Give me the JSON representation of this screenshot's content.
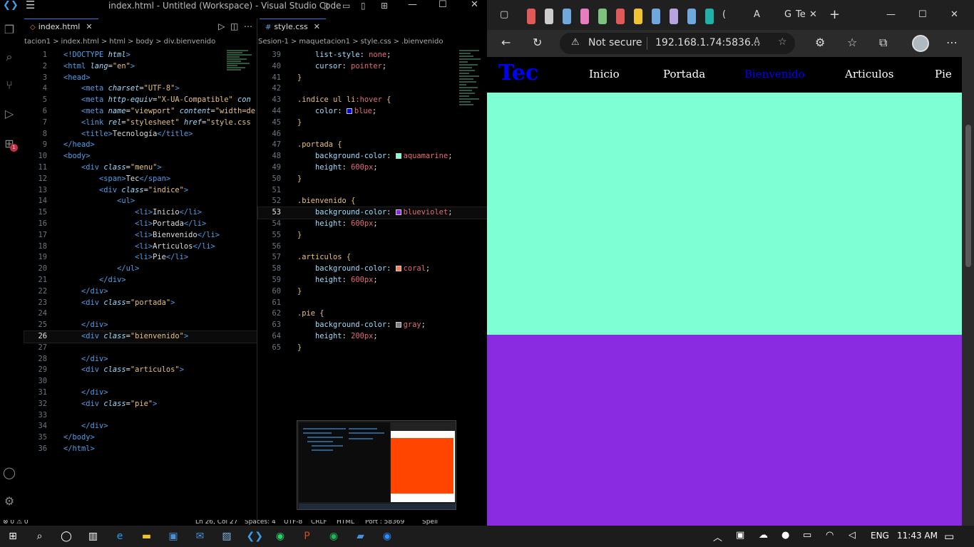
{
  "vscode": {
    "title": "index.html - Untitled (Workspace) - Visual Studio Code",
    "left_tab": "index.html",
    "left_breadcrumbs": [
      "tacion1",
      ">",
      "index.html",
      ">",
      "html",
      ">",
      "body",
      ">",
      "div.bienvenido"
    ],
    "right_tab": "style.css",
    "right_breadcrumbs": [
      "Sesion-1",
      ">",
      "maquetacion1",
      ">",
      "style.css",
      ">",
      ".bienvenido"
    ],
    "extensions_badge": "1",
    "status_items": [
      "⊗ 0 ⚠ 0",
      "Ln 26, Col 27",
      "Spaces: 4",
      "UTF-8",
      "CRLF",
      "HTML",
      "Port : 58369",
      "Spell"
    ],
    "html_lines": [
      {
        "n": "1",
        "segs": [
          [
            "tg",
            "<!DOCTYPE "
          ],
          [
            "at",
            "html"
          ],
          [
            "tg",
            ">"
          ]
        ]
      },
      {
        "n": "2",
        "segs": [
          [
            "tg",
            "<html "
          ],
          [
            "at",
            "lang"
          ],
          [
            "",
            "="
          ],
          [
            "st",
            "\"en\""
          ],
          [
            "tg",
            ">"
          ]
        ]
      },
      {
        "n": "3",
        "segs": [
          [
            "tg",
            "<head>"
          ]
        ]
      },
      {
        "n": "4",
        "segs": [
          [
            "",
            "    "
          ],
          [
            "tg",
            "<meta "
          ],
          [
            "at",
            "charset"
          ],
          [
            "",
            "="
          ],
          [
            "st",
            "\"UTF-8\""
          ],
          [
            "tg",
            ">"
          ]
        ]
      },
      {
        "n": "5",
        "segs": [
          [
            "",
            "    "
          ],
          [
            "tg",
            "<meta "
          ],
          [
            "at",
            "http-equiv"
          ],
          [
            "",
            "="
          ],
          [
            "st",
            "\"X-UA-Compatible\""
          ],
          [
            "at",
            " con"
          ]
        ]
      },
      {
        "n": "6",
        "segs": [
          [
            "",
            "    "
          ],
          [
            "tg",
            "<meta "
          ],
          [
            "at",
            "name"
          ],
          [
            "",
            "="
          ],
          [
            "st",
            "\"viewport\""
          ],
          [
            "at",
            " content"
          ],
          [
            "",
            "="
          ],
          [
            "st",
            "\"width=de"
          ]
        ]
      },
      {
        "n": "7",
        "segs": [
          [
            "",
            "    "
          ],
          [
            "tg",
            "<link "
          ],
          [
            "at",
            "rel"
          ],
          [
            "",
            "="
          ],
          [
            "st",
            "\"stylesheet\""
          ],
          [
            "at",
            " href"
          ],
          [
            "",
            "="
          ],
          [
            "st",
            "\"style.css"
          ]
        ]
      },
      {
        "n": "8",
        "segs": [
          [
            "",
            "    "
          ],
          [
            "tg",
            "<title>"
          ],
          [
            "",
            "Tecnología"
          ],
          [
            "tg",
            "</title>"
          ]
        ]
      },
      {
        "n": "9",
        "segs": [
          [
            "tg",
            "</head>"
          ]
        ]
      },
      {
        "n": "10",
        "segs": [
          [
            "tg",
            "<body>"
          ]
        ]
      },
      {
        "n": "11",
        "segs": [
          [
            "",
            "    "
          ],
          [
            "tg",
            "<div "
          ],
          [
            "at",
            "class"
          ],
          [
            "",
            "="
          ],
          [
            "st",
            "\"menu\""
          ],
          [
            "tg",
            ">"
          ]
        ]
      },
      {
        "n": "12",
        "segs": [
          [
            "",
            "        "
          ],
          [
            "tg",
            "<span>"
          ],
          [
            "",
            "Tec"
          ],
          [
            "tg",
            "</span>"
          ]
        ]
      },
      {
        "n": "13",
        "segs": [
          [
            "",
            "        "
          ],
          [
            "tg",
            "<div "
          ],
          [
            "at",
            "class"
          ],
          [
            "",
            "="
          ],
          [
            "st",
            "\"indice\""
          ],
          [
            "tg",
            ">"
          ]
        ]
      },
      {
        "n": "14",
        "segs": [
          [
            "",
            "            "
          ],
          [
            "tg",
            "<ul>"
          ]
        ]
      },
      {
        "n": "15",
        "segs": [
          [
            "",
            "                "
          ],
          [
            "tg",
            "<li>"
          ],
          [
            "",
            "Inicio"
          ],
          [
            "tg",
            "</li>"
          ]
        ]
      },
      {
        "n": "16",
        "segs": [
          [
            "",
            "                "
          ],
          [
            "tg",
            "<li>"
          ],
          [
            "",
            "Portada"
          ],
          [
            "tg",
            "</li>"
          ]
        ]
      },
      {
        "n": "17",
        "segs": [
          [
            "",
            "                "
          ],
          [
            "tg",
            "<li>"
          ],
          [
            "",
            "Bienvenido"
          ],
          [
            "tg",
            "</li>"
          ]
        ]
      },
      {
        "n": "18",
        "segs": [
          [
            "",
            "                "
          ],
          [
            "tg",
            "<li>"
          ],
          [
            "",
            "Articulos"
          ],
          [
            "tg",
            "</li>"
          ]
        ]
      },
      {
        "n": "19",
        "segs": [
          [
            "",
            "                "
          ],
          [
            "tg",
            "<li>"
          ],
          [
            "",
            "Pie"
          ],
          [
            "tg",
            "</li>"
          ]
        ]
      },
      {
        "n": "20",
        "segs": [
          [
            "",
            "            "
          ],
          [
            "tg",
            "</ul>"
          ]
        ]
      },
      {
        "n": "21",
        "segs": [
          [
            "",
            "        "
          ],
          [
            "tg",
            "</div>"
          ]
        ]
      },
      {
        "n": "22",
        "segs": [
          [
            "",
            "    "
          ],
          [
            "tg",
            "</div>"
          ]
        ]
      },
      {
        "n": "23",
        "segs": [
          [
            "",
            "    "
          ],
          [
            "tg",
            "<div "
          ],
          [
            "at",
            "class"
          ],
          [
            "",
            "="
          ],
          [
            "st",
            "\"portada\""
          ],
          [
            "tg",
            ">"
          ]
        ]
      },
      {
        "n": "24",
        "segs": [
          [
            "",
            ""
          ]
        ]
      },
      {
        "n": "25",
        "segs": [
          [
            "",
            "    "
          ],
          [
            "tg",
            "</div>"
          ]
        ]
      },
      {
        "n": "26",
        "segs": [
          [
            "",
            "    "
          ],
          [
            "tg",
            "<div "
          ],
          [
            "at",
            "class"
          ],
          [
            "",
            "="
          ],
          [
            "st",
            "\"bienvenido\""
          ],
          [
            "tg",
            ">"
          ]
        ],
        "current": true
      },
      {
        "n": "27",
        "segs": [
          [
            "",
            ""
          ]
        ]
      },
      {
        "n": "28",
        "segs": [
          [
            "",
            "    "
          ],
          [
            "tg",
            "</div>"
          ]
        ]
      },
      {
        "n": "29",
        "segs": [
          [
            "",
            "    "
          ],
          [
            "tg",
            "<div "
          ],
          [
            "at",
            "class"
          ],
          [
            "",
            "="
          ],
          [
            "st",
            "\"articulos\""
          ],
          [
            "tg",
            ">"
          ]
        ]
      },
      {
        "n": "30",
        "segs": [
          [
            "",
            ""
          ]
        ]
      },
      {
        "n": "31",
        "segs": [
          [
            "",
            "    "
          ],
          [
            "tg",
            "</div>"
          ]
        ]
      },
      {
        "n": "32",
        "segs": [
          [
            "",
            "    "
          ],
          [
            "tg",
            "<div "
          ],
          [
            "at",
            "class"
          ],
          [
            "",
            "="
          ],
          [
            "st",
            "\"pie\""
          ],
          [
            "tg",
            ">"
          ]
        ]
      },
      {
        "n": "33",
        "segs": [
          [
            "",
            ""
          ]
        ]
      },
      {
        "n": "34",
        "segs": [
          [
            "",
            "    "
          ],
          [
            "tg",
            "</div>"
          ]
        ]
      },
      {
        "n": "35",
        "segs": [
          [
            "tg",
            "</body>"
          ]
        ]
      },
      {
        "n": "36",
        "segs": [
          [
            "tg",
            "</html>"
          ]
        ]
      }
    ],
    "css_lines": [
      {
        "n": "39",
        "segs": [
          [
            "",
            "    "
          ],
          [
            "pr",
            "list-style"
          ],
          [
            "",
            ": "
          ],
          [
            "vl",
            "none"
          ],
          [
            "",
            ";"
          ]
        ]
      },
      {
        "n": "40",
        "segs": [
          [
            "",
            "    "
          ],
          [
            "pr",
            "cursor"
          ],
          [
            "",
            ": "
          ],
          [
            "vl",
            "pointer"
          ],
          [
            "",
            ";"
          ]
        ]
      },
      {
        "n": "41",
        "segs": [
          [
            "br",
            "}"
          ]
        ]
      },
      {
        "n": "42",
        "segs": [
          [
            "",
            ""
          ]
        ]
      },
      {
        "n": "43",
        "segs": [
          [
            "sel",
            ".indice ul li"
          ],
          [
            "vl",
            ":hover"
          ],
          [
            "br",
            " {"
          ]
        ]
      },
      {
        "n": "44",
        "segs": [
          [
            "",
            "    "
          ],
          [
            "pr",
            "color"
          ],
          [
            "",
            ": "
          ],
          [
            "sw",
            "#0000ff"
          ],
          [
            "vl",
            "blue"
          ],
          [
            "",
            ";"
          ]
        ]
      },
      {
        "n": "45",
        "segs": [
          [
            "br",
            "}"
          ]
        ]
      },
      {
        "n": "46",
        "segs": [
          [
            "",
            ""
          ]
        ]
      },
      {
        "n": "47",
        "segs": [
          [
            "sel",
            ".portada"
          ],
          [
            "br",
            " {"
          ]
        ]
      },
      {
        "n": "48",
        "segs": [
          [
            "",
            "    "
          ],
          [
            "pr",
            "background-color"
          ],
          [
            "",
            ": "
          ],
          [
            "sw",
            "#7fffd4"
          ],
          [
            "vl",
            "aquamarine"
          ],
          [
            "",
            ";"
          ]
        ]
      },
      {
        "n": "49",
        "segs": [
          [
            "",
            "    "
          ],
          [
            "pr",
            "height"
          ],
          [
            "",
            ": "
          ],
          [
            "vl",
            "600px"
          ],
          [
            "",
            ";"
          ]
        ]
      },
      {
        "n": "50",
        "segs": [
          [
            "br",
            "}"
          ]
        ]
      },
      {
        "n": "51",
        "segs": [
          [
            "",
            ""
          ]
        ]
      },
      {
        "n": "52",
        "segs": [
          [
            "sel",
            ".bienvenido"
          ],
          [
            "br",
            " {"
          ]
        ]
      },
      {
        "n": "53",
        "segs": [
          [
            "",
            "    "
          ],
          [
            "pr",
            "background-color"
          ],
          [
            "",
            ": "
          ],
          [
            "sw",
            "#8a2be2"
          ],
          [
            "vl",
            "blueviolet"
          ],
          [
            "",
            ";"
          ]
        ],
        "current": true
      },
      {
        "n": "54",
        "segs": [
          [
            "",
            "    "
          ],
          [
            "pr",
            "height"
          ],
          [
            "",
            ": "
          ],
          [
            "vl",
            "600px"
          ],
          [
            "",
            ";"
          ]
        ]
      },
      {
        "n": "55",
        "segs": [
          [
            "br",
            "}"
          ]
        ]
      },
      {
        "n": "56",
        "segs": [
          [
            "",
            ""
          ]
        ]
      },
      {
        "n": "57",
        "segs": [
          [
            "sel",
            ".articulos"
          ],
          [
            "br",
            " {"
          ]
        ]
      },
      {
        "n": "58",
        "segs": [
          [
            "",
            "    "
          ],
          [
            "pr",
            "background-color"
          ],
          [
            "",
            ": "
          ],
          [
            "sw",
            "#ff7f50"
          ],
          [
            "vl",
            "coral"
          ],
          [
            "",
            ";"
          ]
        ]
      },
      {
        "n": "59",
        "segs": [
          [
            "",
            "    "
          ],
          [
            "pr",
            "height"
          ],
          [
            "",
            ": "
          ],
          [
            "vl",
            "600px"
          ],
          [
            "",
            ";"
          ]
        ]
      },
      {
        "n": "60",
        "segs": [
          [
            "br",
            "}"
          ]
        ]
      },
      {
        "n": "61",
        "segs": [
          [
            "",
            ""
          ]
        ]
      },
      {
        "n": "62",
        "segs": [
          [
            "sel",
            ".pie"
          ],
          [
            "br",
            " {"
          ]
        ]
      },
      {
        "n": "63",
        "segs": [
          [
            "",
            "    "
          ],
          [
            "pr",
            "background-color"
          ],
          [
            "",
            ": "
          ],
          [
            "sw",
            "#808080"
          ],
          [
            "vl",
            "gray"
          ],
          [
            "",
            ";"
          ]
        ]
      },
      {
        "n": "64",
        "segs": [
          [
            "",
            "    "
          ],
          [
            "pr",
            "height"
          ],
          [
            "",
            ": "
          ],
          [
            "vl",
            "200px"
          ],
          [
            "",
            ";"
          ]
        ]
      },
      {
        "n": "65",
        "segs": [
          [
            "br",
            "}"
          ]
        ]
      }
    ]
  },
  "edge": {
    "address_warning": "Not secure",
    "url": "192.168.1.74:5836...",
    "tab_partial_labels": [
      "(",
      "A",
      "G",
      "Te"
    ],
    "tab_colors": [
      "#e05a5a",
      "#cccccc",
      "#6fa8dc",
      "#e87cc0",
      "#7cc47c",
      "#e05a5a",
      "#f1c232",
      "#6fa8dc",
      "#b7a3e0",
      "#6fa8dc",
      "#20b2aa"
    ],
    "page": {
      "brand": "Tec",
      "menu": [
        "Inicio",
        "Portada",
        "Bienvenido",
        "Articulos",
        "Pie"
      ],
      "hover_item": "Bienvenido",
      "colors": {
        "menu_bg": "#000000",
        "brand": "#0000ff",
        "hover": "#0000ff",
        "portada": "#7fffd4",
        "bienvenido": "#8a2be2"
      }
    }
  },
  "taskbar": {
    "lang": "ENG",
    "time": "11:43 AM",
    "apps": [
      "windows-icon",
      "search-icon",
      "cortana-icon",
      "task-view-icon",
      "edge-icon",
      "file-explorer-icon",
      "store-icon",
      "mail-icon",
      "photos-icon",
      "vscode-icon",
      "whatsapp-icon",
      "powerpoint-icon",
      "spotify-icon",
      "paint-icon",
      "zoom-icon"
    ]
  }
}
